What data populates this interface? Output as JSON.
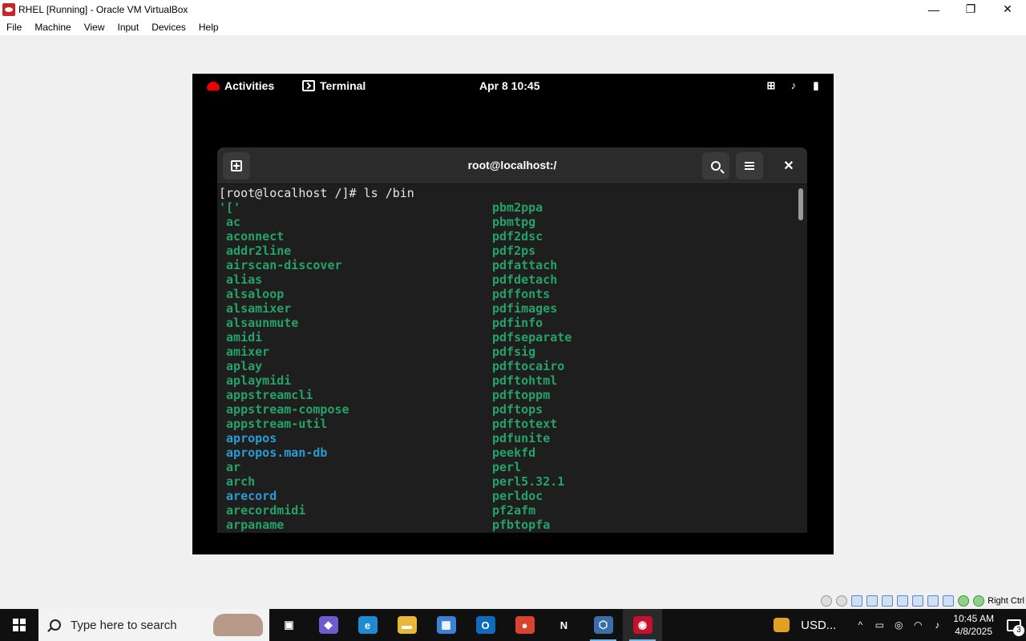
{
  "vbox": {
    "title": "RHEL [Running] - Oracle VM VirtualBox",
    "menu": [
      "File",
      "Machine",
      "View",
      "Input",
      "Devices",
      "Help"
    ],
    "host_key": "Right Ctrl",
    "window_controls": {
      "minimize": "—",
      "restore": "❐",
      "close": "✕"
    }
  },
  "gnome": {
    "activities": "Activities",
    "app_name": "Terminal",
    "clock": "Apr 8  10:45",
    "tray_icons": [
      "network-icon",
      "volume-icon",
      "battery-icon"
    ]
  },
  "terminal": {
    "title": "root@localhost:/",
    "close_glyph": "✕",
    "prompt": "[root@localhost /]# ls /bin",
    "left_column": [
      {
        "name": "'['",
        "link": false
      },
      {
        "name": " ac",
        "link": false
      },
      {
        "name": " aconnect",
        "link": false
      },
      {
        "name": " addr2line",
        "link": false
      },
      {
        "name": " airscan-discover",
        "link": false
      },
      {
        "name": " alias",
        "link": false
      },
      {
        "name": " alsaloop",
        "link": false
      },
      {
        "name": " alsamixer",
        "link": false
      },
      {
        "name": " alsaunmute",
        "link": false
      },
      {
        "name": " amidi",
        "link": false
      },
      {
        "name": " amixer",
        "link": false
      },
      {
        "name": " aplay",
        "link": false
      },
      {
        "name": " aplaymidi",
        "link": false
      },
      {
        "name": " appstreamcli",
        "link": false
      },
      {
        "name": " appstream-compose",
        "link": false
      },
      {
        "name": " appstream-util",
        "link": false
      },
      {
        "name": " apropos",
        "link": true
      },
      {
        "name": " apropos.man-db",
        "link": true
      },
      {
        "name": " ar",
        "link": false
      },
      {
        "name": " arch",
        "link": false
      },
      {
        "name": " arecord",
        "link": true
      },
      {
        "name": " arecordmidi",
        "link": false
      },
      {
        "name": " arpaname",
        "link": false
      }
    ],
    "right_column": [
      {
        "name": "pbm2ppa",
        "link": false
      },
      {
        "name": "pbmtpg",
        "link": false
      },
      {
        "name": "pdf2dsc",
        "link": false
      },
      {
        "name": "pdf2ps",
        "link": false
      },
      {
        "name": "pdfattach",
        "link": false
      },
      {
        "name": "pdfdetach",
        "link": false
      },
      {
        "name": "pdffonts",
        "link": false
      },
      {
        "name": "pdfimages",
        "link": false
      },
      {
        "name": "pdfinfo",
        "link": false
      },
      {
        "name": "pdfseparate",
        "link": false
      },
      {
        "name": "pdfsig",
        "link": false
      },
      {
        "name": "pdftocairo",
        "link": false
      },
      {
        "name": "pdftohtml",
        "link": false
      },
      {
        "name": "pdftoppm",
        "link": false
      },
      {
        "name": "pdftops",
        "link": false
      },
      {
        "name": "pdftotext",
        "link": false
      },
      {
        "name": "pdfunite",
        "link": false
      },
      {
        "name": "peekfd",
        "link": false
      },
      {
        "name": "perl",
        "link": false
      },
      {
        "name": "perl5.32.1",
        "link": false
      },
      {
        "name": "perldoc",
        "link": false
      },
      {
        "name": "pf2afm",
        "link": false
      },
      {
        "name": "pfbtopfa",
        "link": false
      }
    ],
    "colors": {
      "exec": "#26a269",
      "link": "#2a9bd3",
      "bg": "#1e1e1e"
    }
  },
  "taskbar": {
    "search_placeholder": "Type here to search",
    "apps": [
      {
        "name": "task-view-icon",
        "glyph": "▣",
        "color": "#101010"
      },
      {
        "name": "copilot-icon",
        "glyph": "◆",
        "color": "#6d5bd0"
      },
      {
        "name": "edge-icon",
        "glyph": "e",
        "color": "#1f8ad6"
      },
      {
        "name": "file-explorer-icon",
        "glyph": "▬",
        "color": "#e8b838"
      },
      {
        "name": "microsoft-store-icon",
        "glyph": "▦",
        "color": "#3b82d6"
      },
      {
        "name": "outlook-icon",
        "glyph": "O",
        "color": "#0f6cbd"
      },
      {
        "name": "chrome-icon",
        "glyph": "●",
        "color": "#d9432f"
      },
      {
        "name": "netflix-icon",
        "glyph": "N",
        "color": "#101010"
      },
      {
        "name": "virtualbox-icon",
        "glyph": "⬡",
        "color": "#3a6ea8"
      },
      {
        "name": "rhel-vm-icon",
        "glyph": "◉",
        "color": "#c8102e"
      }
    ],
    "currency": "USD...",
    "time": "10:45 AM",
    "date": "4/8/2025",
    "notification_count": "3"
  }
}
